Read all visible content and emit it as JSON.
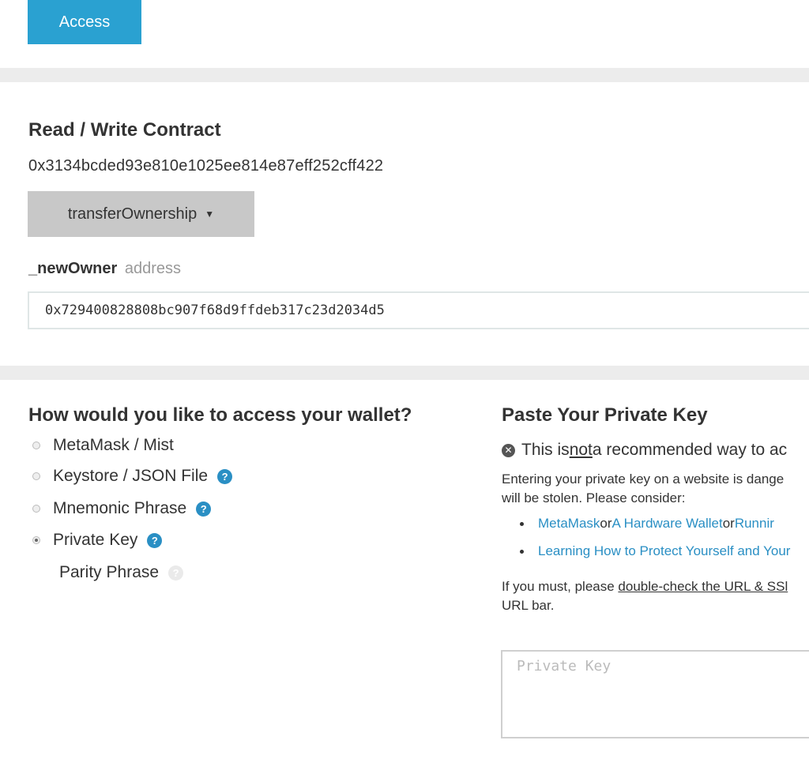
{
  "header": {
    "access_button": "Access"
  },
  "contract": {
    "title": "Read / Write Contract",
    "address": "0x3134bcded93e810e1025ee814e87eff252cff422",
    "function_selected": "transferOwnership",
    "param": {
      "name": "_newOwner",
      "type": "address",
      "value": "0x729400828808bc907f68d9ffdeb317c23d2034d5"
    }
  },
  "wallet_access": {
    "title": "How would you like to access your wallet?",
    "options": [
      {
        "label": "MetaMask / Mist",
        "checked": false,
        "help": false
      },
      {
        "label": "Keystore / JSON File",
        "checked": false,
        "help": true
      },
      {
        "label": "Mnemonic Phrase",
        "checked": false,
        "help": true
      },
      {
        "label": "Private Key",
        "checked": true,
        "help": true
      }
    ],
    "parity": "Parity Phrase"
  },
  "private_key_panel": {
    "title": "Paste Your Private Key",
    "warning_pre": "This is ",
    "warning_not": "not",
    "warning_post": " a recommended way to ac",
    "para1_line1": "Entering your private key on a website is dange",
    "para1_line2": "will be stolen. Please consider:",
    "bullet1": {
      "link1": "MetaMask",
      "or1": " or ",
      "link2": "A Hardware Wallet",
      "or2": " or ",
      "link3": "Runnir"
    },
    "bullet2": {
      "link": "Learning How to Protect Yourself and Your"
    },
    "para2_pre": "If you must, please ",
    "para2_link": "double-check the URL & SSl",
    "para2_line2": "URL bar.",
    "input_placeholder": "Private Key"
  },
  "colors": {
    "accent": "#2aa1d1",
    "link": "#2a8fc4",
    "dropdown_bg": "#c8c8c8"
  }
}
